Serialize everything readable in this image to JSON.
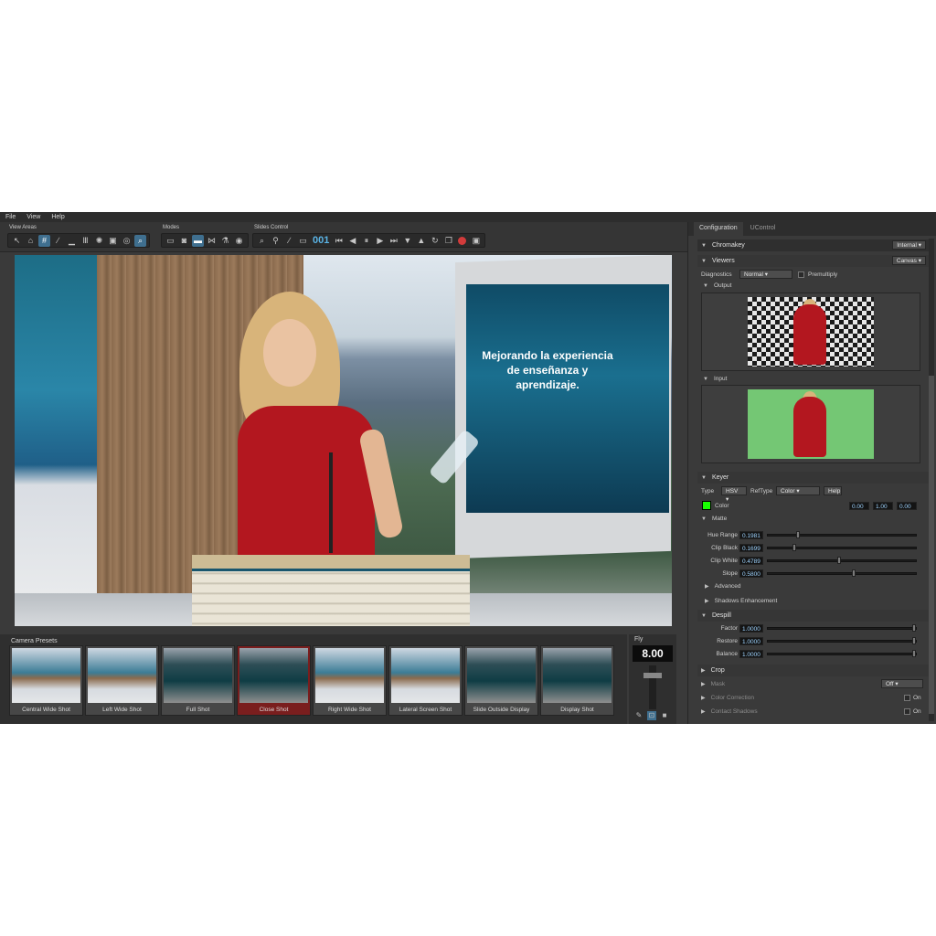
{
  "menu": [
    "File",
    "View",
    "Help"
  ],
  "toolbar": {
    "view_areas_title": "View Areas",
    "modes_title": "Modes",
    "slides_control_title": "Slides Control",
    "counter": "001"
  },
  "viewport": {
    "screen_text": "Mejorando la experiencia de enseñanza y aprendizaje."
  },
  "camera_presets": {
    "title": "Camera Presets",
    "items": [
      {
        "label": "Central Wide Shot"
      },
      {
        "label": "Left Wide Shot"
      },
      {
        "label": "Full Shot"
      },
      {
        "label": "Close Shot",
        "selected": true
      },
      {
        "label": "Right Wide Shot"
      },
      {
        "label": "Lateral Screen Shot"
      },
      {
        "label": "Slide Outside Display"
      },
      {
        "label": "Display Shot"
      }
    ]
  },
  "fly": {
    "title": "Fly",
    "value": "8.00"
  },
  "right_panel": {
    "tabs": [
      "Configuration",
      "UControl"
    ],
    "chromakey": {
      "label": "Chromakey",
      "mode": "Internal"
    },
    "viewers": {
      "label": "Viewers",
      "target": "Canvas",
      "diagnostics_label": "Diagnostics",
      "diagnostics_value": "Normal",
      "premultiply_label": "Premultiply",
      "output_label": "Output",
      "input_label": "Input"
    },
    "keyer": {
      "label": "Keyer",
      "type_label": "Type",
      "type_value": "HSV",
      "reftype_label": "RefType",
      "reftype_value": "Color",
      "help_label": "Help",
      "color_label": "Color",
      "color_values": [
        "0.00",
        "1.00",
        "0.00"
      ],
      "swatch_color": "#18ff00",
      "matte_label": "Matte",
      "params": [
        {
          "label": "Hue Range",
          "value": "0.1981",
          "level": 0.1981
        },
        {
          "label": "Clip Black",
          "value": "0.1699",
          "level": 0.1699
        },
        {
          "label": "Clip White",
          "value": "0.4789",
          "level": 0.4789
        },
        {
          "label": "Slope",
          "value": "0.5800",
          "level": 0.58
        }
      ],
      "advanced_label": "Advanced",
      "shadows_label": "Shadows Enhancement"
    },
    "despill": {
      "label": "Despill",
      "params": [
        {
          "label": "Factor",
          "value": "1.0000",
          "level": 1.0
        },
        {
          "label": "Restore",
          "value": "1.0000",
          "level": 1.0
        },
        {
          "label": "Balance",
          "value": "1.0000",
          "level": 1.0
        }
      ]
    },
    "crop": {
      "label": "Crop"
    },
    "mask": {
      "label": "Mask",
      "value": "Off"
    },
    "color_correction": {
      "label": "Color Correction",
      "value": "On"
    },
    "contact_shadows": {
      "label": "Contact Shadows",
      "value": "On"
    }
  }
}
